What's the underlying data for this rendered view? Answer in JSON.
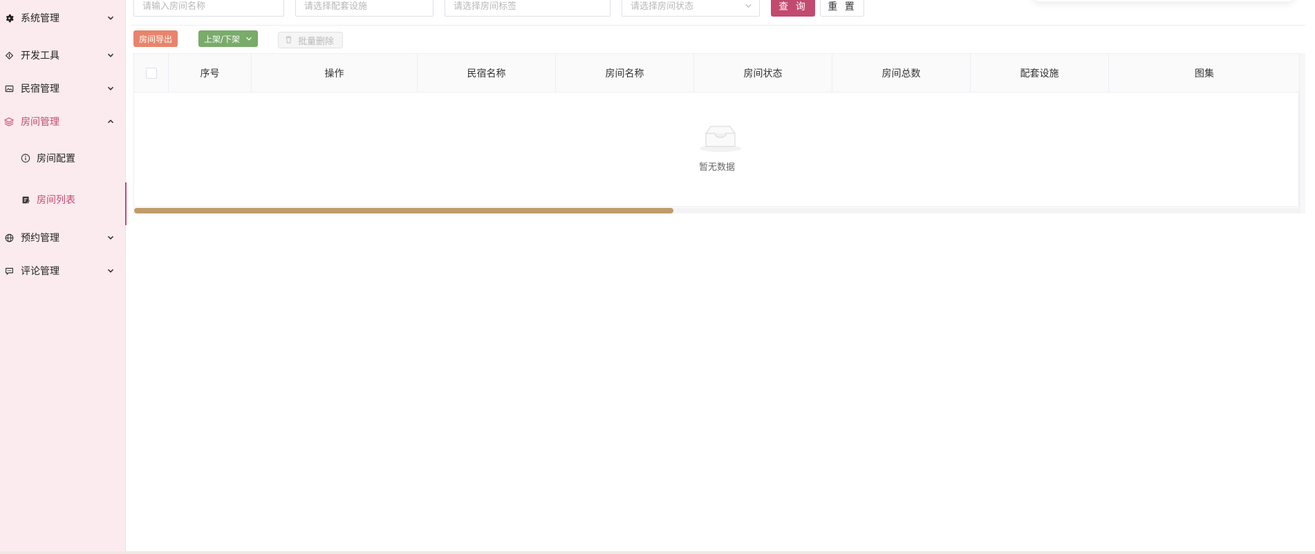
{
  "sidebar": {
    "menus": [
      {
        "label": "系统管理",
        "icon": "gear-icon",
        "expanded": false
      },
      {
        "label": "开发工具",
        "icon": "tools-icon",
        "expanded": false
      },
      {
        "label": "民宿管理",
        "icon": "image-icon",
        "expanded": false
      },
      {
        "label": "房间管理",
        "icon": "layers-icon",
        "expanded": true
      },
      {
        "label": "预约管理",
        "icon": "globe-icon",
        "expanded": false
      },
      {
        "label": "评论管理",
        "icon": "message-icon",
        "expanded": false
      }
    ],
    "sub_items": [
      {
        "label": "房间配置",
        "icon": "info-icon",
        "active": false
      },
      {
        "label": "房间列表",
        "icon": "edit-list-icon",
        "active": true
      }
    ]
  },
  "filters": {
    "room_name_placeholder": "请输入房间名称",
    "facility_placeholder": "请选择配套设施",
    "tag_placeholder": "请选择房间标签",
    "status_placeholder": "请选择房间状态",
    "query_label": "查 询",
    "reset_label": "重 置"
  },
  "toolbar": {
    "export_label": "房间导出",
    "shelf_label": "上架/下架",
    "batch_delete_label": "批量删除"
  },
  "table": {
    "columns": [
      "序号",
      "操作",
      "民宿名称",
      "房间名称",
      "房间状态",
      "房间总数",
      "配套设施",
      "图集"
    ],
    "rows": [],
    "empty_text": "暂无数据"
  },
  "colors": {
    "accent": "#c24a6f",
    "sidebar_bg": "#fbebef",
    "export_btn": "#e8846b",
    "shelf_btn": "#79ab6a",
    "scroll_thumb": "#c09b6b"
  }
}
